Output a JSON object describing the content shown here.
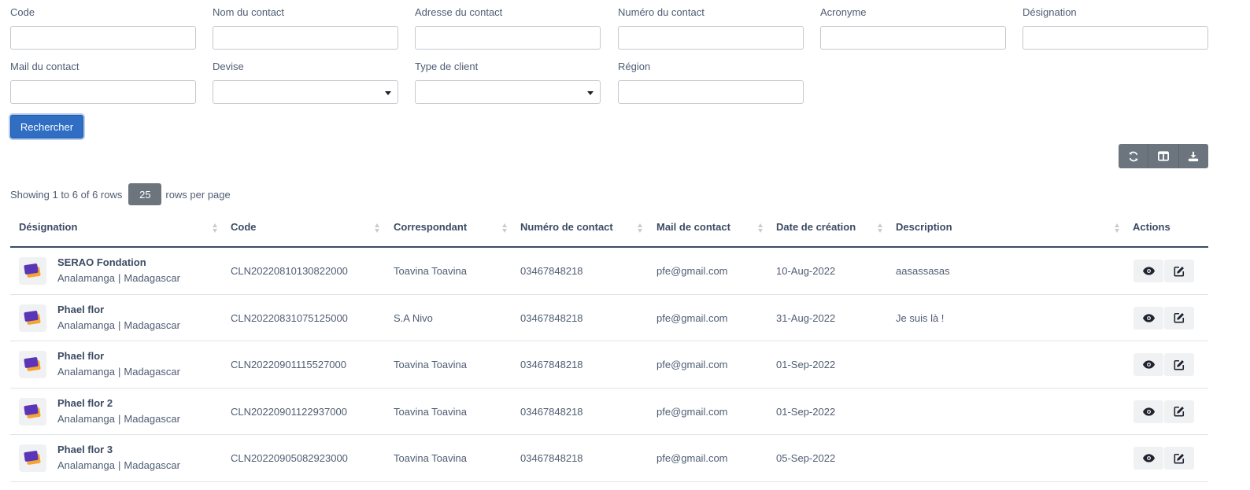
{
  "filters": {
    "code": {
      "label": "Code",
      "value": ""
    },
    "contact_name": {
      "label": "Nom du contact",
      "value": ""
    },
    "contact_address": {
      "label": "Adresse du contact",
      "value": ""
    },
    "contact_number": {
      "label": "Numéro du contact",
      "value": ""
    },
    "acronym": {
      "label": "Acronyme",
      "value": ""
    },
    "designation": {
      "label": "Désignation",
      "value": ""
    },
    "contact_mail": {
      "label": "Mail du contact",
      "value": ""
    },
    "currency": {
      "label": "Devise",
      "value": ""
    },
    "client_type": {
      "label": "Type de client",
      "value": ""
    },
    "region": {
      "label": "Région",
      "value": ""
    }
  },
  "search_button": "Rechercher",
  "toolbar": {
    "refresh_icon": "refresh-icon",
    "columns_icon": "columns-icon",
    "export_icon": "download-icon"
  },
  "pagination": {
    "showing": "Showing 1 to 6 of 6 rows",
    "rows_per_page_value": "25",
    "rows_per_page_label": "rows per page"
  },
  "table": {
    "columns": [
      "Désignation",
      "Code",
      "Correspondant",
      "Numéro de contact",
      "Mail de contact",
      "Date de création",
      "Description",
      "Actions"
    ],
    "rows": [
      {
        "name": "SERAO Fondation",
        "region": "Analamanga",
        "country": "Madagascar",
        "code": "CLN20220810130822000",
        "correspondent": "Toavina Toavina",
        "phone": "03467848218",
        "mail": "pfe@gmail.com",
        "created": "10-Aug-2022",
        "description": "aasassasas"
      },
      {
        "name": "Phael flor",
        "region": "Analamanga",
        "country": "Madagascar",
        "code": "CLN20220831075125000",
        "correspondent": "S.A Nivo",
        "phone": "03467848218",
        "mail": "pfe@gmail.com",
        "created": "31-Aug-2022",
        "description": "Je suis là !"
      },
      {
        "name": "Phael flor",
        "region": "Analamanga",
        "country": "Madagascar",
        "code": "CLN20220901115527000",
        "correspondent": "Toavina Toavina",
        "phone": "03467848218",
        "mail": "pfe@gmail.com",
        "created": "01-Sep-2022",
        "description": ""
      },
      {
        "name": "Phael flor 2",
        "region": "Analamanga",
        "country": "Madagascar",
        "code": "CLN20220901122937000",
        "correspondent": "Toavina Toavina",
        "phone": "03467848218",
        "mail": "pfe@gmail.com",
        "created": "01-Sep-2022",
        "description": ""
      },
      {
        "name": "Phael flor 3",
        "region": "Analamanga",
        "country": "Madagascar",
        "code": "CLN20220905082923000",
        "correspondent": "Toavina Toavina",
        "phone": "03467848218",
        "mail": "pfe@gmail.com",
        "created": "05-Sep-2022",
        "description": ""
      }
    ]
  },
  "colors": {
    "primary": "#2f6ec3",
    "secondary": "#6c757d",
    "text": "#3c4b64"
  }
}
